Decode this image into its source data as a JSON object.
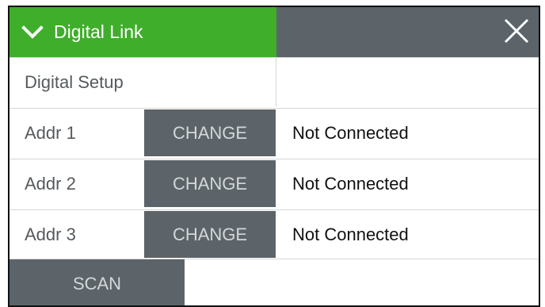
{
  "header": {
    "title": "Digital Link",
    "collapse_icon": "chevron-down-icon",
    "close_icon": "close-icon",
    "accent_color": "#3fae2a",
    "bar_color": "#5c6469"
  },
  "setup_row": {
    "label": "Digital Setup"
  },
  "addresses": [
    {
      "label": "Addr 1",
      "button": "CHANGE",
      "status": "Not Connected"
    },
    {
      "label": "Addr 2",
      "button": "CHANGE",
      "status": "Not Connected"
    },
    {
      "label": "Addr 3",
      "button": "CHANGE",
      "status": "Not Connected"
    }
  ],
  "footer": {
    "scan_label": "SCAN"
  }
}
